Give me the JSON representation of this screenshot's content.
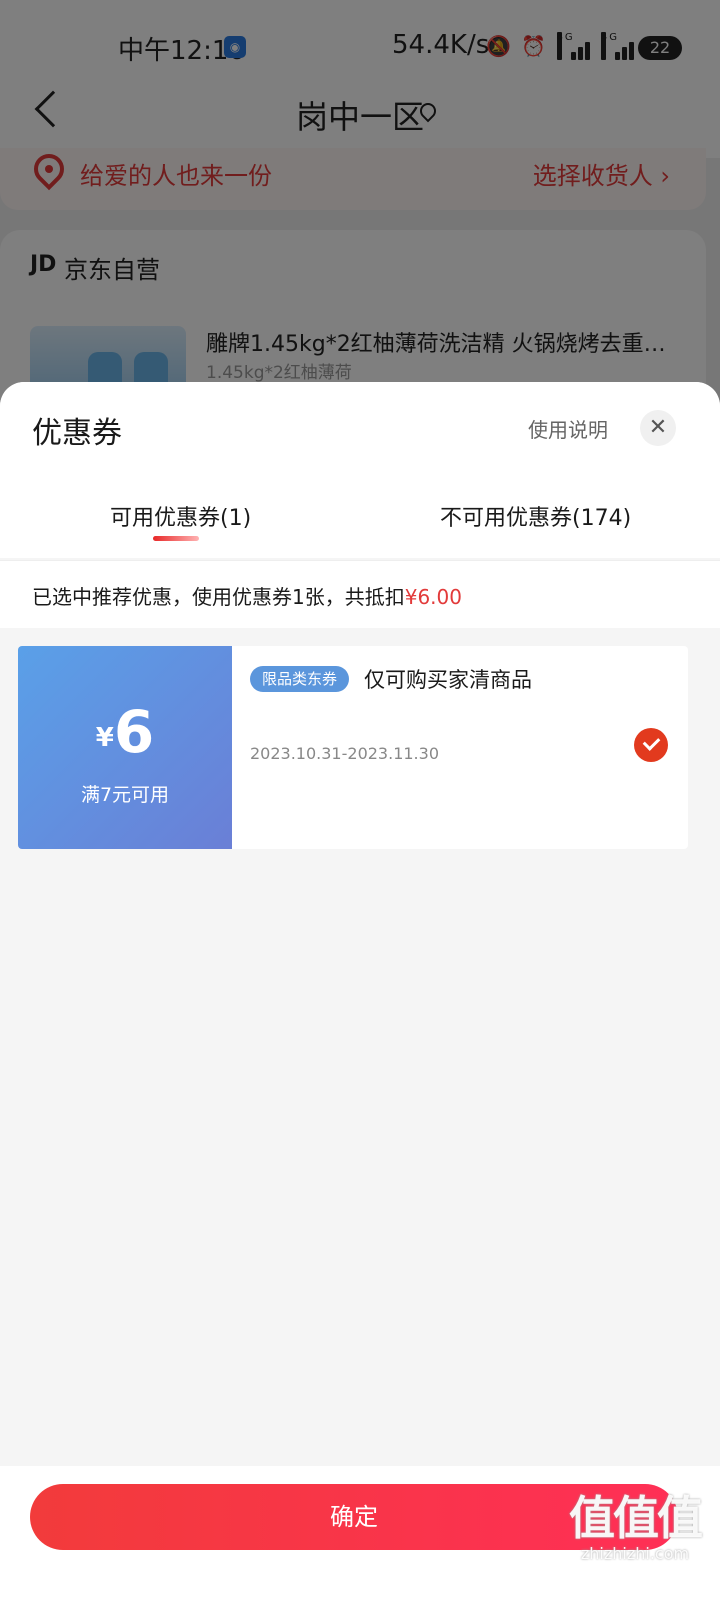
{
  "status_bar": {
    "time": "中午12:16",
    "network_speed": "54.4K/s",
    "signal_tag": "4G",
    "battery": "22"
  },
  "nav": {
    "title": "岗中一区"
  },
  "gift": {
    "text": "给爱的人也来一份",
    "action": "选择收货人 ›"
  },
  "shop": {
    "logo": "JD",
    "name": "京东自营",
    "product_title": "雕牌1.45kg*2红柚薄荷洗洁精 火锅烧烤去重…",
    "product_spec": "1.45kg*2红柚薄荷"
  },
  "sheet": {
    "title": "优惠券",
    "help": "使用说明",
    "close": "✕",
    "tabs": [
      {
        "label": "可用优惠券(1)",
        "active": true
      },
      {
        "label": "不可用优惠券(174)",
        "active": false
      }
    ],
    "summary_prefix": "已选中推荐优惠，使用优惠券1张，共抵扣",
    "summary_amount": "¥6.00"
  },
  "coupon": {
    "currency": "¥",
    "amount": "6",
    "condition": "满7元可用",
    "badge": "限品类东券",
    "description": "仅可购买家清商品",
    "date_range": "2023.10.31-2023.11.30",
    "selected": true
  },
  "footer": {
    "confirm_label": "确定"
  },
  "watermark": {
    "glyphs": "值值值",
    "domain": "zhizhizhi.com"
  }
}
